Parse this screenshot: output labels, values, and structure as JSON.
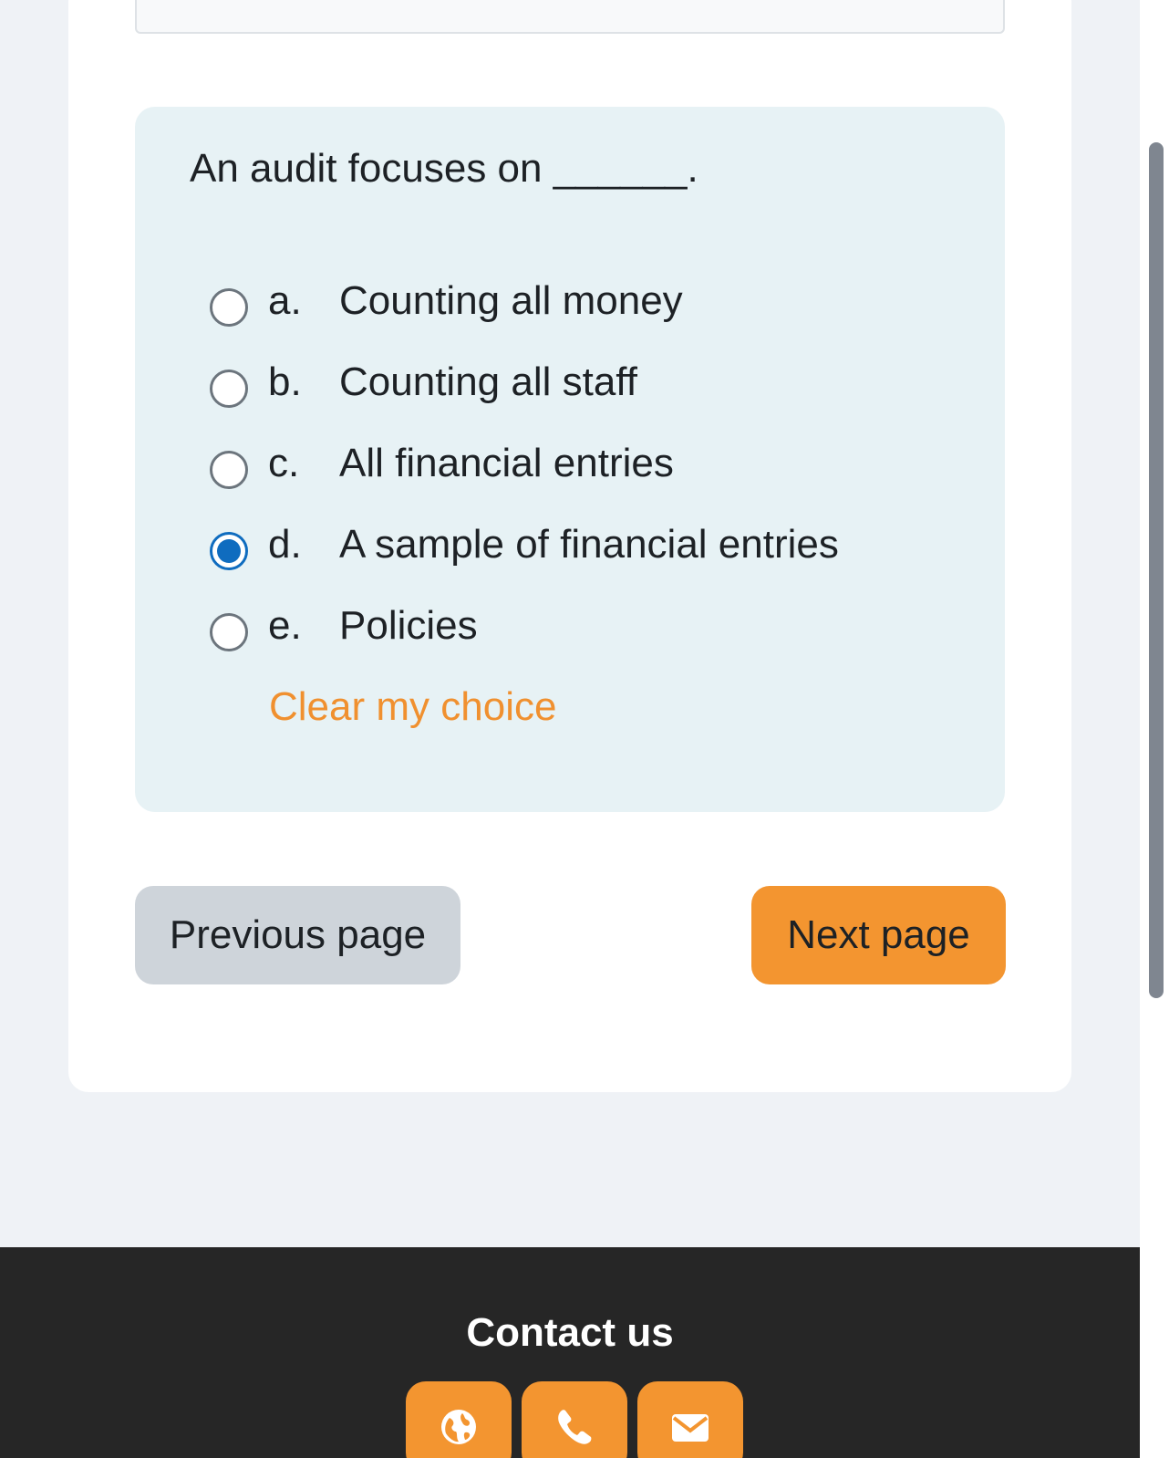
{
  "question": {
    "text": "An audit focuses on ______.",
    "answers": [
      {
        "letter": "a.",
        "text": "Counting all money",
        "selected": false
      },
      {
        "letter": "b.",
        "text": "Counting all staff",
        "selected": false
      },
      {
        "letter": "c.",
        "text": "All financial entries",
        "selected": false
      },
      {
        "letter": "d.",
        "text": "A sample of financial entries",
        "selected": true
      },
      {
        "letter": "e.",
        "text": "Policies",
        "selected": false
      }
    ],
    "clear_label": "Clear my choice"
  },
  "navigation": {
    "previous_label": "Previous page",
    "next_label": "Next page"
  },
  "footer": {
    "title": "Contact us",
    "buttons": [
      {
        "icon": "globe-icon"
      },
      {
        "icon": "phone-icon"
      },
      {
        "icon": "envelope-icon"
      }
    ]
  },
  "colors": {
    "accent": "#f39530",
    "link": "#f0902f",
    "radio_selected": "#0f6cbf",
    "question_bg": "#e7f2f5",
    "footer_bg": "#262626"
  }
}
